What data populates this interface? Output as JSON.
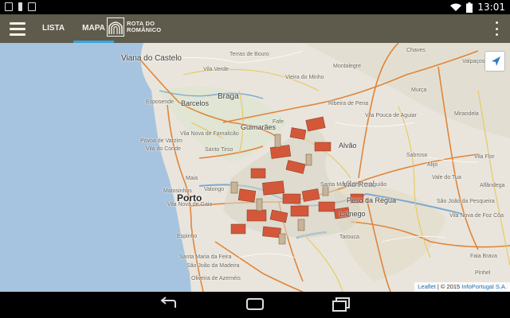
{
  "status_bar": {
    "time": "13:01",
    "icons": [
      "sim-icon",
      "notification-icon",
      "image-icon",
      "wifi-icon",
      "battery-icon"
    ]
  },
  "action_bar": {
    "menu_icon": "hamburger-menu-icon",
    "tabs": [
      {
        "label": "LISTA",
        "active": false
      },
      {
        "label": "MAPA",
        "active": true
      }
    ],
    "brand_line1": "ROTA DO",
    "brand_line2": "ROMÂNICO",
    "overflow_icon": "more-vert-icon",
    "accent_color": "#3aa3d8",
    "bar_color": "#5e5a4c"
  },
  "map": {
    "places": {
      "viana": "Viana do Castelo",
      "terras_bouro": "Terras de Bouro",
      "chaves": "Chaves",
      "vila_verde": "Vila Verde",
      "vieira": "Vieira do Minho",
      "montalegre": "Montalegre",
      "valpacos": "Valpaços",
      "esposende": "Esposende",
      "barcelos": "Barcelos",
      "braga": "Braga",
      "ribeira_pena": "Ribeira de Pena",
      "vila_pouca": "Vila Pouca de Aguiar",
      "murca": "Murça",
      "mirandela": "Mirandela",
      "guimaraes": "Guimarães",
      "fafe": "Fafe",
      "famalicao": "Vila Nova de Famalicão",
      "povoa": "Póvoa de Varzim",
      "vila_conde": "Vila do Conde",
      "santo_tirso": "Santo Tirso",
      "alvao": "Alvão",
      "vila_real": "Vila Real",
      "sabrosa": "Sabrosa",
      "alijo": "Alijó",
      "vila_flor": "Vila Flor",
      "maia": "Maia",
      "valongo": "Valongo",
      "matosinhos": "Matosinhos",
      "porto": "Porto",
      "vng": "Vila Nova de Gaia",
      "santa_marta": "Santa Marta de Penaguião",
      "regua": "Peso da Régua",
      "lamego": "Lamego",
      "sao_joao": "São João da Pesqueira",
      "vn_foz": "Vila Nova de Foz Côa",
      "espinho": "Espinho",
      "tarouca": "Tarouca",
      "feira": "Santa Maria da Feira",
      "sao_joao_madeira": "São João da Madeira",
      "oliveira": "Oliveira de Azeméis",
      "faia": "Faia Brava",
      "pinhel": "Pinhel",
      "vale_tua": "Vale do Tua",
      "alfandega": "Alfândega"
    },
    "locate_icon": "location-arrow-icon",
    "attribution": {
      "leaflet": "Leaflet",
      "middle": " | © 2015 ",
      "provider": "InfoPortugal S.A."
    }
  },
  "nav_bar": {
    "back_icon": "back-icon",
    "home_icon": "home-icon",
    "recents_icon": "recent-apps-icon"
  }
}
